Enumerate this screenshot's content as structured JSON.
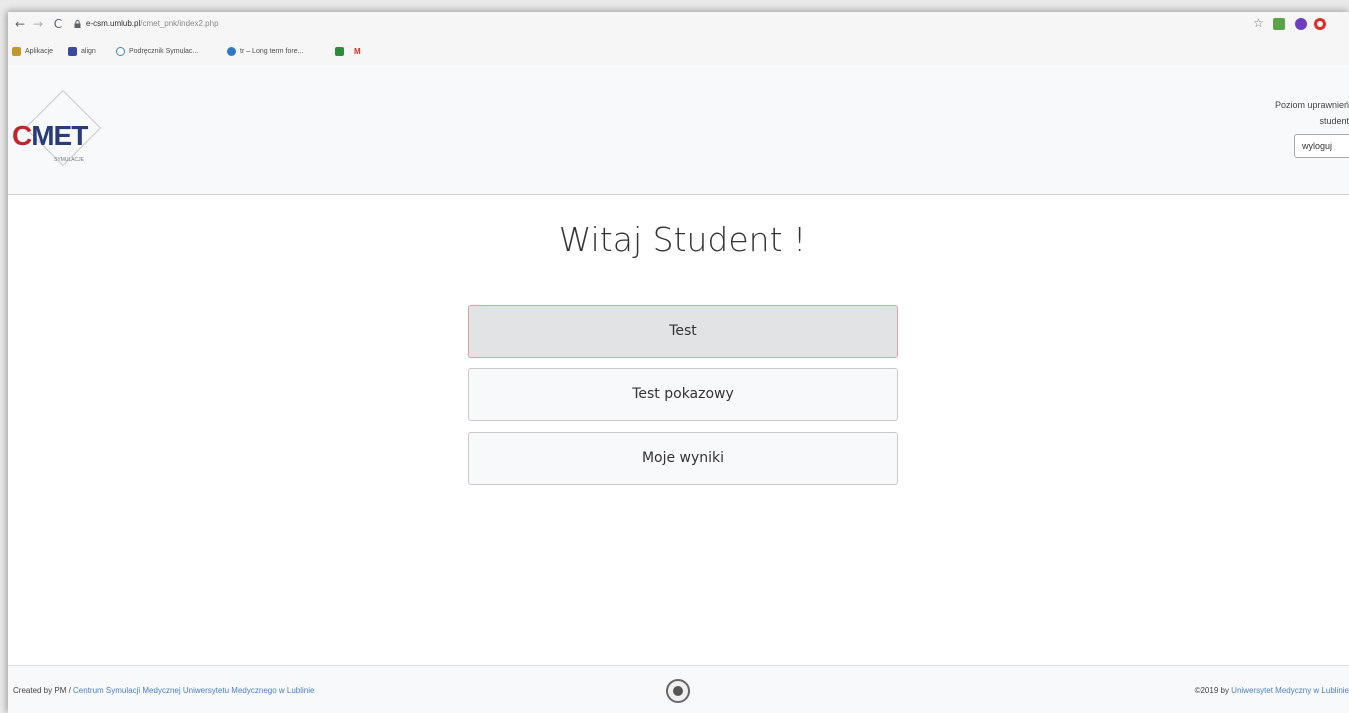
{
  "browser": {
    "url_host": "e-csm.umlub.pl",
    "url_path": "/cmet_pnk/index2.php",
    "bookmarks": [
      {
        "label": "Aplikacje",
        "color": "#c29a2c"
      },
      {
        "label": "align",
        "color": "#3b4a9e"
      },
      {
        "label": "Podręcznik Symulac...",
        "color": "#3b82c4"
      },
      {
        "label": "tr – Long term fore...",
        "color": "#2f78c4"
      },
      {
        "label": "",
        "color": "#2e8b3a"
      },
      {
        "label": "M",
        "color": "#d93025"
      }
    ]
  },
  "header": {
    "logo": {
      "c": "C",
      "rest": "MET",
      "sub": "SYMULACJE"
    },
    "permission_label": "Poziom uprawnień",
    "permission_value": "student",
    "logout_label": "wyloguj"
  },
  "main": {
    "welcome": "Witaj Student !",
    "buttons": {
      "test": "Test",
      "demo": "Test pokazowy",
      "results": "Moje wyniki"
    }
  },
  "footer": {
    "created_by": "Created by PM / ",
    "center_link": "Centrum Symulacji Medycznej Uniwersytetu Medycznego w Lublinie",
    "copyright": "©2019 by ",
    "university_link": "Uniwersytet Medyczny w Lublinie"
  },
  "colors": {
    "brand_red": "#c0272d",
    "brand_blue": "#2a3c78",
    "link": "#4a7fc1"
  }
}
